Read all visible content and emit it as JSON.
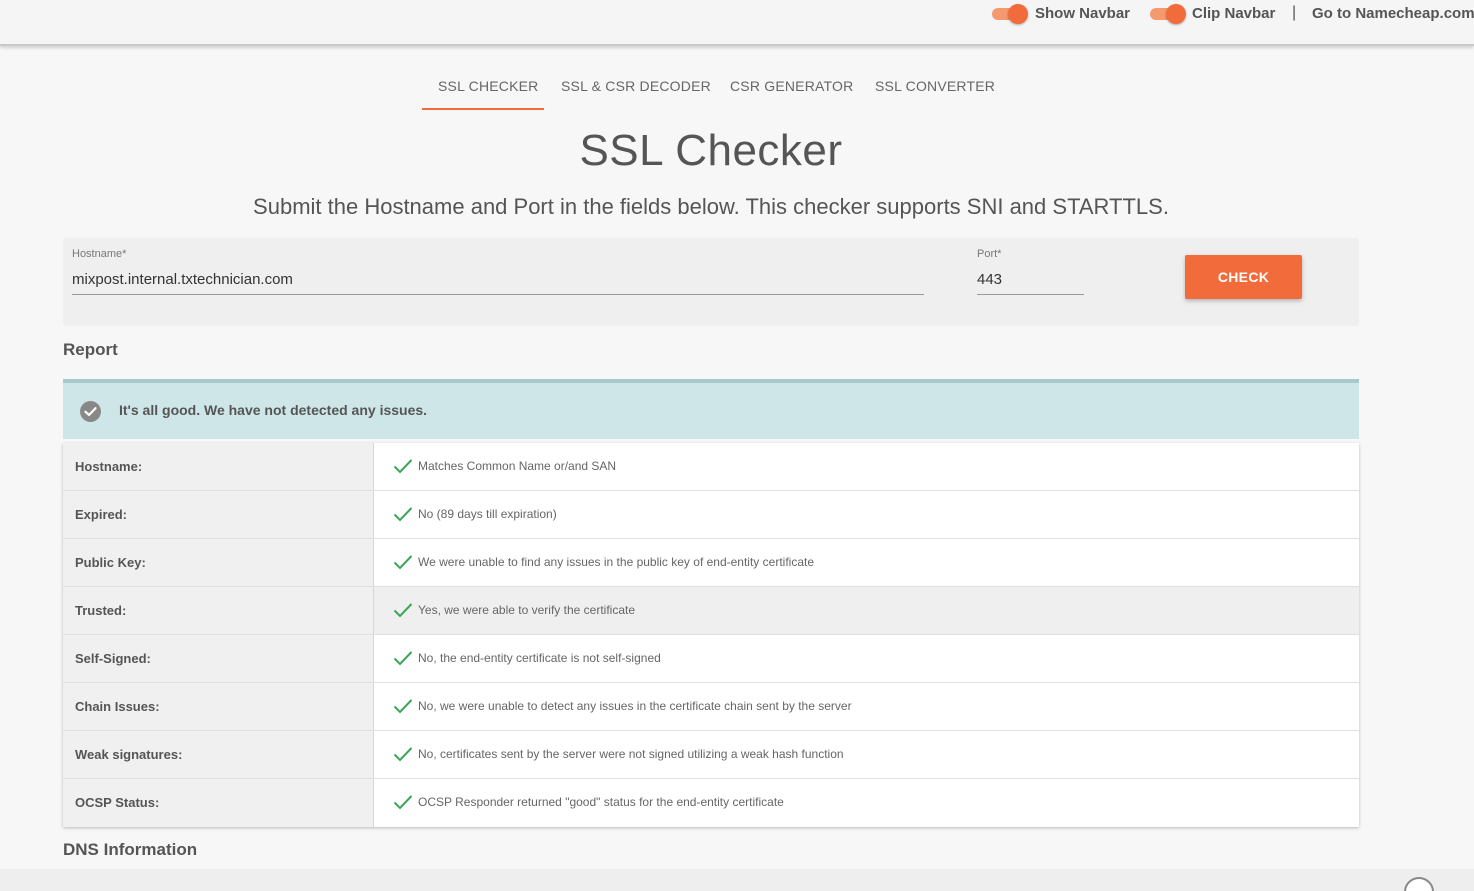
{
  "topbar": {
    "show_navbar_label": "Show Navbar",
    "clip_navbar_label": "Clip Navbar",
    "separator": "|",
    "go_to_label": "Go to Namecheap.com",
    "toggle_color": "#f26b3a"
  },
  "tabs": [
    {
      "label": "SSL CHECKER",
      "active": true
    },
    {
      "label": "SSL & CSR DECODER",
      "active": false
    },
    {
      "label": "CSR GENERATOR",
      "active": false
    },
    {
      "label": "SSL CONVERTER",
      "active": false
    }
  ],
  "page": {
    "title": "SSL Checker",
    "subtitle": "Submit the Hostname and Port in the fields below. This checker supports SNI and STARTTLS."
  },
  "form": {
    "hostname_label": "Hostname*",
    "hostname_value": "mixpost.internal.txtechnician.com",
    "port_label": "Port*",
    "port_value": "443",
    "check_button": "CHECK"
  },
  "report": {
    "heading": "Report",
    "banner_text": "It's all good. We have not detected any issues.",
    "rows": [
      {
        "label": "Hostname:",
        "value": "Matches Common Name or/and SAN"
      },
      {
        "label": "Expired:",
        "value": "No (89 days till expiration)"
      },
      {
        "label": "Public Key:",
        "value": "We were unable to find any issues in the public key of end-entity certificate"
      },
      {
        "label": "Trusted:",
        "value": "Yes, we were able to verify the certificate"
      },
      {
        "label": "Self-Signed:",
        "value": "No, the end-entity certificate is not self-signed"
      },
      {
        "label": "Chain Issues:",
        "value": "No, we were unable to detect any issues in the certificate chain sent by the server"
      },
      {
        "label": "Weak signatures:",
        "value": "No, certificates sent by the server were not signed utilizing a weak hash function"
      },
      {
        "label": "OCSP Status:",
        "value": "OCSP Responder returned \"good\" status for the end-entity certificate"
      }
    ]
  },
  "dns": {
    "heading": "DNS Information"
  },
  "colors": {
    "accent": "#f26b3a",
    "banner_bg": "#cfe6e8",
    "check_green": "#3aa655"
  }
}
